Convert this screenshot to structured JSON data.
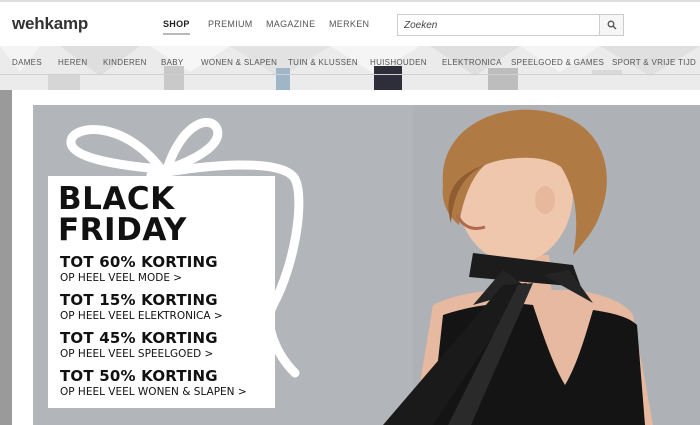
{
  "header": {
    "logo": "wehkamp",
    "nav": [
      {
        "label": "SHOP",
        "active": true
      },
      {
        "label": "PREMIUM",
        "active": false
      },
      {
        "label": "MAGAZINE",
        "active": false
      },
      {
        "label": "MERKEN",
        "active": false
      }
    ],
    "search": {
      "placeholder": "Zoeken",
      "icon": "search-icon"
    }
  },
  "categories": [
    "DAMES",
    "HEREN",
    "KINDEREN",
    "BABY",
    "WONEN & SLAPEN",
    "TUIN & KLUSSEN",
    "HUISHOUDEN",
    "ELEKTRONICA",
    "SPEELGOED & GAMES",
    "SPORT & VRIJE TIJD"
  ],
  "banner": {
    "title_line1": "BLACK",
    "title_line2": "FRIDAY",
    "offers": [
      {
        "headline": "TOT 60% KORTING",
        "link": "OP HEEL VEEL MODE >"
      },
      {
        "headline": "TOT 15% KORTING",
        "link": "OP HEEL VEEL ELEKTRONICA >"
      },
      {
        "headline": "TOT 45% KORTING",
        "link": "OP HEEL VEEL SPEELGOED >"
      },
      {
        "headline": "TOT 50% KORTING",
        "link": "OP HEEL VEEL WONEN & SLAPEN >"
      }
    ]
  },
  "colors": {
    "banner_background": "#b2b6ba",
    "text": "#111111",
    "accent_line": "#f08a4b"
  }
}
